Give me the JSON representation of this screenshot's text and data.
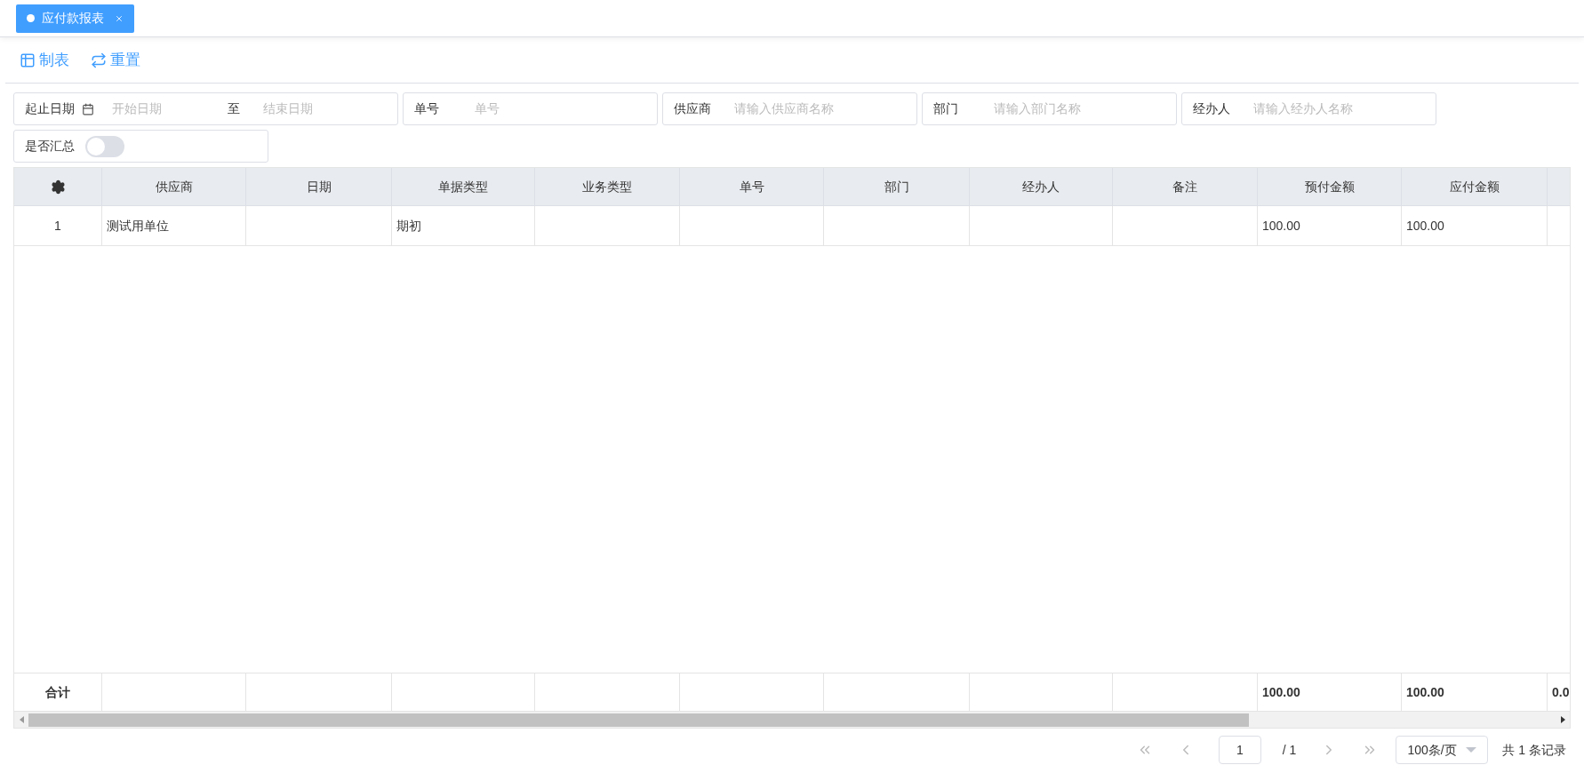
{
  "tabs": [
    {
      "label": "应付款报表",
      "selected": true
    }
  ],
  "toolbar": [
    {
      "kind": "table",
      "label": "制表"
    },
    {
      "kind": "reset",
      "label": "重置"
    }
  ],
  "filters": [
    {
      "kind": "date_range",
      "label": "起止日期",
      "start_placeholder": "开始日期",
      "separator": "至",
      "end_placeholder": "结束日期"
    },
    {
      "kind": "text",
      "label": "单号",
      "placeholder": "单号"
    },
    {
      "kind": "text",
      "label": "供应商",
      "placeholder": "请输入供应商名称"
    },
    {
      "kind": "text",
      "label": "部门",
      "placeholder": "请输入部门名称"
    },
    {
      "kind": "text",
      "label": "经办人",
      "placeholder": "请输入经办人名称"
    },
    {
      "kind": "switch",
      "label": "是否汇总",
      "on": false
    }
  ],
  "table": {
    "columns": [
      "供应商",
      "日期",
      "单据类型",
      "业务类型",
      "单号",
      "部门",
      "经办人",
      "备注",
      "预付金额",
      "应付金额"
    ],
    "rows": [
      {
        "index": "1",
        "cells": [
          "测试用单位",
          null,
          "期初",
          null,
          null,
          null,
          null,
          null,
          "100.00",
          "100.00",
          null
        ]
      }
    ],
    "total": {
      "label": "合计",
      "cells": [
        null,
        null,
        null,
        null,
        null,
        null,
        null,
        null,
        "100.00",
        "100.00",
        "0.0"
      ]
    }
  },
  "pagination": {
    "page": "1",
    "page_count": "/ 1",
    "page_size": "100条/页",
    "summary": "共 1 条记录"
  }
}
